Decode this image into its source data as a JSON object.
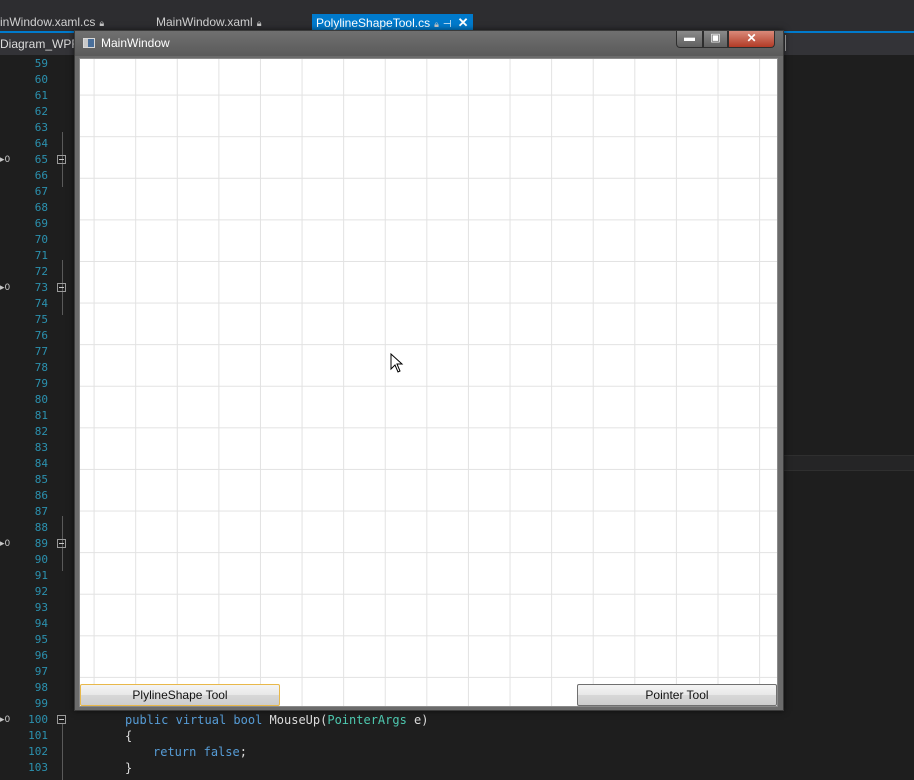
{
  "ide": {
    "tabs": [
      {
        "label": "inWindow.xaml.cs"
      },
      {
        "label": "MainWindow.xaml"
      },
      {
        "label": "PolylineShapeTool.cs"
      }
    ],
    "project_label": "Diagram_WPF",
    "line_numbers": [
      "59",
      "60",
      "61",
      "62",
      "63",
      "64",
      "65",
      "66",
      "67",
      "68",
      "69",
      "70",
      "71",
      "72",
      "73",
      "74",
      "75",
      "76",
      "77",
      "78",
      "79",
      "80",
      "81",
      "82",
      "83",
      "84",
      "85",
      "86",
      "87",
      "88",
      "89",
      "90",
      "91",
      "92",
      "93",
      "94",
      "95",
      "96",
      "97",
      "98",
      "99",
      "100",
      "101",
      "102",
      "103"
    ],
    "code": {
      "l100_kw1": "public",
      "l100_kw2": "virtual",
      "l100_kw3": "bool",
      "l100_name": "MouseUp(",
      "l100_type": "PointerArgs",
      "l100_end": " e)",
      "l101": "{",
      "l102_kw": "return",
      "l102_kw2": "false",
      "l102_end": ";",
      "l103": "}"
    }
  },
  "window": {
    "title": "MainWindow",
    "minimize_label": "▬",
    "maximize_label": "▣",
    "close_label": "✕",
    "buttons": {
      "left_label": "PlylineShape Tool",
      "right_label": "Pointer Tool"
    }
  },
  "colors": {
    "accent": "#007acc",
    "line_number": "#2b91af",
    "keyword": "#569cd6",
    "type": "#4ec9b0",
    "close_button": "#c0392b"
  }
}
